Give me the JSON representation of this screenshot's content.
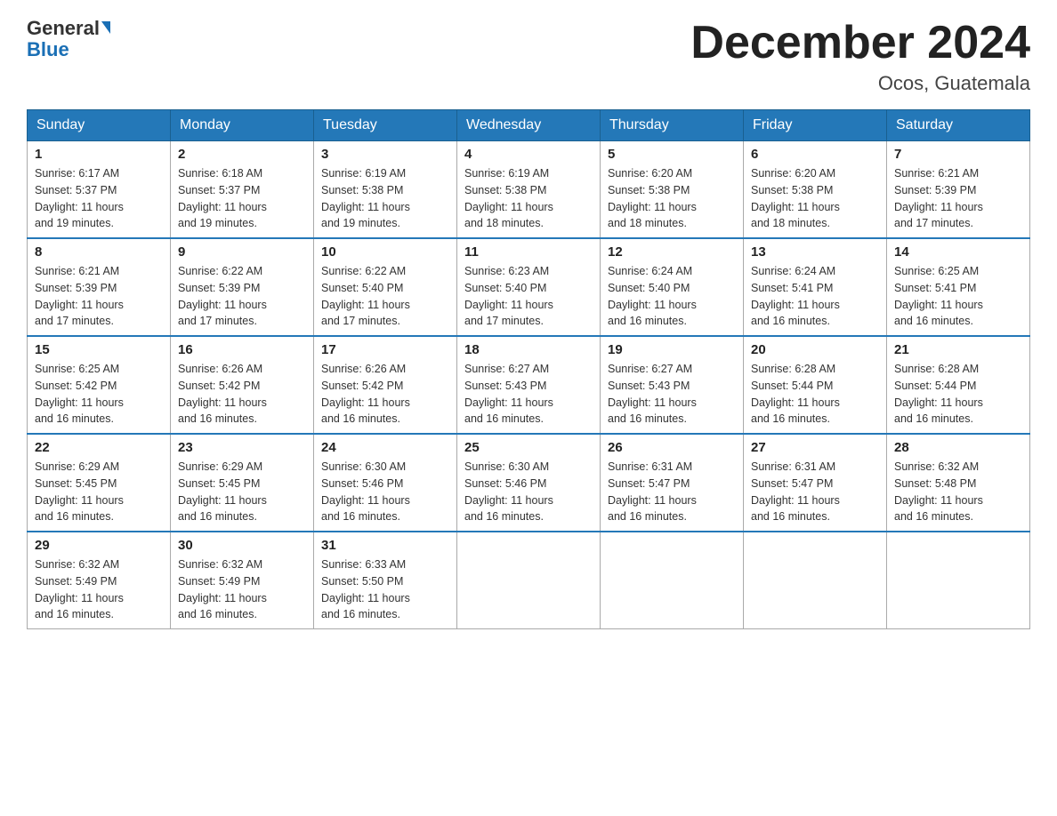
{
  "header": {
    "logo_general": "General",
    "logo_blue": "Blue",
    "title": "December 2024",
    "subtitle": "Ocos, Guatemala"
  },
  "days_of_week": [
    "Sunday",
    "Monday",
    "Tuesday",
    "Wednesday",
    "Thursday",
    "Friday",
    "Saturday"
  ],
  "weeks": [
    [
      {
        "day": "1",
        "sunrise": "6:17 AM",
        "sunset": "5:37 PM",
        "daylight": "11 hours and 19 minutes."
      },
      {
        "day": "2",
        "sunrise": "6:18 AM",
        "sunset": "5:37 PM",
        "daylight": "11 hours and 19 minutes."
      },
      {
        "day": "3",
        "sunrise": "6:19 AM",
        "sunset": "5:38 PM",
        "daylight": "11 hours and 19 minutes."
      },
      {
        "day": "4",
        "sunrise": "6:19 AM",
        "sunset": "5:38 PM",
        "daylight": "11 hours and 18 minutes."
      },
      {
        "day": "5",
        "sunrise": "6:20 AM",
        "sunset": "5:38 PM",
        "daylight": "11 hours and 18 minutes."
      },
      {
        "day": "6",
        "sunrise": "6:20 AM",
        "sunset": "5:38 PM",
        "daylight": "11 hours and 18 minutes."
      },
      {
        "day": "7",
        "sunrise": "6:21 AM",
        "sunset": "5:39 PM",
        "daylight": "11 hours and 17 minutes."
      }
    ],
    [
      {
        "day": "8",
        "sunrise": "6:21 AM",
        "sunset": "5:39 PM",
        "daylight": "11 hours and 17 minutes."
      },
      {
        "day": "9",
        "sunrise": "6:22 AM",
        "sunset": "5:39 PM",
        "daylight": "11 hours and 17 minutes."
      },
      {
        "day": "10",
        "sunrise": "6:22 AM",
        "sunset": "5:40 PM",
        "daylight": "11 hours and 17 minutes."
      },
      {
        "day": "11",
        "sunrise": "6:23 AM",
        "sunset": "5:40 PM",
        "daylight": "11 hours and 17 minutes."
      },
      {
        "day": "12",
        "sunrise": "6:24 AM",
        "sunset": "5:40 PM",
        "daylight": "11 hours and 16 minutes."
      },
      {
        "day": "13",
        "sunrise": "6:24 AM",
        "sunset": "5:41 PM",
        "daylight": "11 hours and 16 minutes."
      },
      {
        "day": "14",
        "sunrise": "6:25 AM",
        "sunset": "5:41 PM",
        "daylight": "11 hours and 16 minutes."
      }
    ],
    [
      {
        "day": "15",
        "sunrise": "6:25 AM",
        "sunset": "5:42 PM",
        "daylight": "11 hours and 16 minutes."
      },
      {
        "day": "16",
        "sunrise": "6:26 AM",
        "sunset": "5:42 PM",
        "daylight": "11 hours and 16 minutes."
      },
      {
        "day": "17",
        "sunrise": "6:26 AM",
        "sunset": "5:42 PM",
        "daylight": "11 hours and 16 minutes."
      },
      {
        "day": "18",
        "sunrise": "6:27 AM",
        "sunset": "5:43 PM",
        "daylight": "11 hours and 16 minutes."
      },
      {
        "day": "19",
        "sunrise": "6:27 AM",
        "sunset": "5:43 PM",
        "daylight": "11 hours and 16 minutes."
      },
      {
        "day": "20",
        "sunrise": "6:28 AM",
        "sunset": "5:44 PM",
        "daylight": "11 hours and 16 minutes."
      },
      {
        "day": "21",
        "sunrise": "6:28 AM",
        "sunset": "5:44 PM",
        "daylight": "11 hours and 16 minutes."
      }
    ],
    [
      {
        "day": "22",
        "sunrise": "6:29 AM",
        "sunset": "5:45 PM",
        "daylight": "11 hours and 16 minutes."
      },
      {
        "day": "23",
        "sunrise": "6:29 AM",
        "sunset": "5:45 PM",
        "daylight": "11 hours and 16 minutes."
      },
      {
        "day": "24",
        "sunrise": "6:30 AM",
        "sunset": "5:46 PM",
        "daylight": "11 hours and 16 minutes."
      },
      {
        "day": "25",
        "sunrise": "6:30 AM",
        "sunset": "5:46 PM",
        "daylight": "11 hours and 16 minutes."
      },
      {
        "day": "26",
        "sunrise": "6:31 AM",
        "sunset": "5:47 PM",
        "daylight": "11 hours and 16 minutes."
      },
      {
        "day": "27",
        "sunrise": "6:31 AM",
        "sunset": "5:47 PM",
        "daylight": "11 hours and 16 minutes."
      },
      {
        "day": "28",
        "sunrise": "6:32 AM",
        "sunset": "5:48 PM",
        "daylight": "11 hours and 16 minutes."
      }
    ],
    [
      {
        "day": "29",
        "sunrise": "6:32 AM",
        "sunset": "5:49 PM",
        "daylight": "11 hours and 16 minutes."
      },
      {
        "day": "30",
        "sunrise": "6:32 AM",
        "sunset": "5:49 PM",
        "daylight": "11 hours and 16 minutes."
      },
      {
        "day": "31",
        "sunrise": "6:33 AM",
        "sunset": "5:50 PM",
        "daylight": "11 hours and 16 minutes."
      },
      null,
      null,
      null,
      null
    ]
  ],
  "labels": {
    "sunrise": "Sunrise:",
    "sunset": "Sunset:",
    "daylight": "Daylight:"
  }
}
